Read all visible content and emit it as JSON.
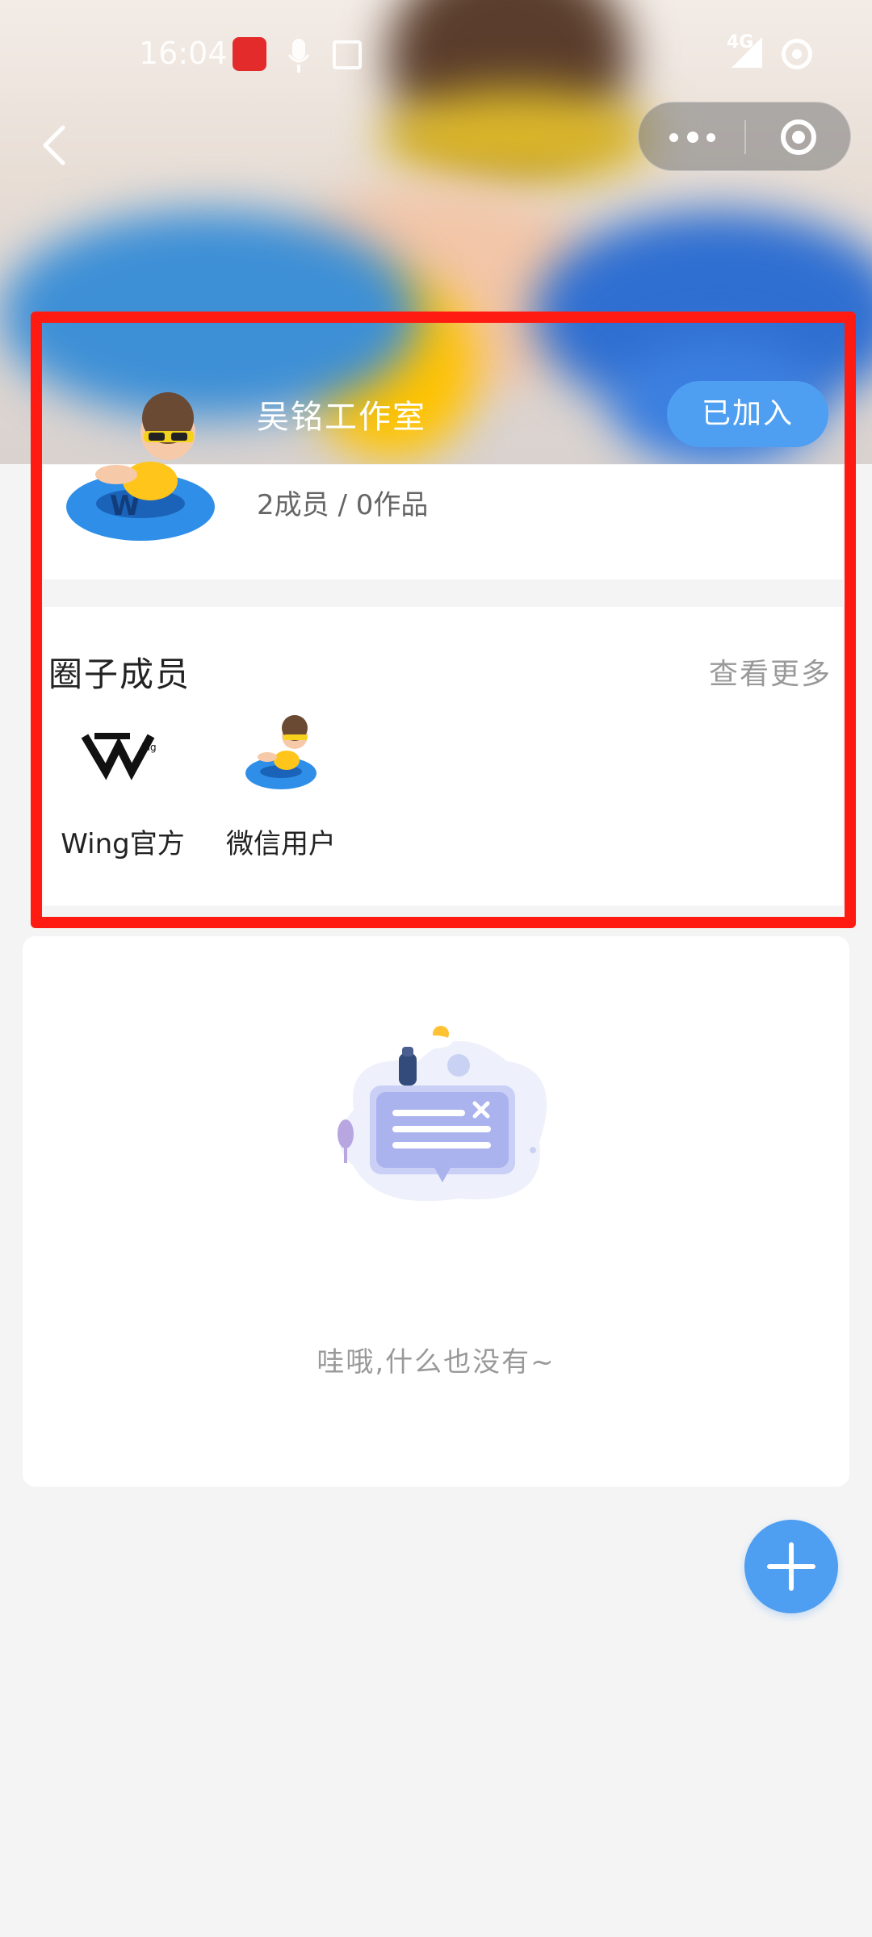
{
  "status_bar": {
    "time": "16:04",
    "network": "4G",
    "icons": [
      "wallet-app-icon",
      "mic-icon",
      "image-icon",
      "signal-icon",
      "location-icon"
    ]
  },
  "nav": {
    "back_icon": "chevron-left-icon",
    "more_icon": "more-dots-icon",
    "close_icon": "target-close-icon"
  },
  "circle": {
    "name": "吴铭工作室",
    "joined_label": "已加入",
    "stats": "2成员 / 0作品"
  },
  "members": {
    "title": "圈子成员",
    "see_more": "查看更多",
    "items": [
      {
        "name": "Wing官方",
        "icon": "wing-logo-icon"
      },
      {
        "name": "微信用户",
        "icon": "swim-ring-avatar-icon"
      }
    ]
  },
  "empty_state": {
    "text": "哇哦,什么也没有~",
    "icon": "empty-message-illustration"
  },
  "fab": {
    "icon": "plus-icon"
  },
  "colors": {
    "accent": "#4e9ef1",
    "highlight": "#ff1a12",
    "background": "#f4f4f4"
  }
}
